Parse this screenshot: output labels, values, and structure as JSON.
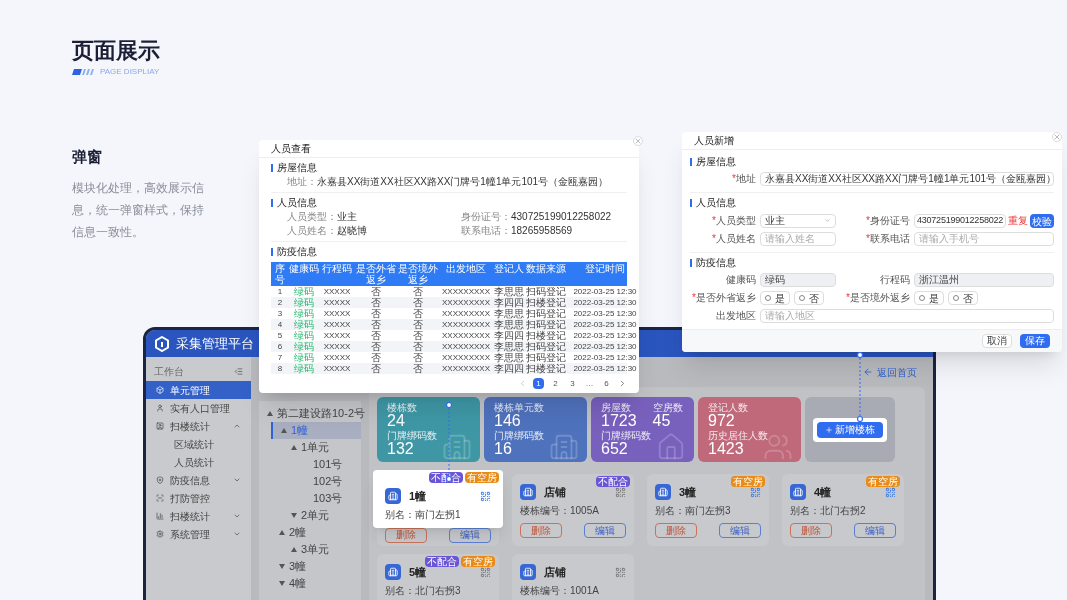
{
  "page": {
    "title": "页面展示",
    "subtitle": "PAGE DISPLIAY"
  },
  "section": {
    "title": "弹窗",
    "description": "模块化处理，高效展示信息，统一弹窗样式，保持信息一致性。"
  },
  "app": {
    "logo_text": "采集管理平台",
    "sidebar": {
      "header": "工作台",
      "items": [
        {
          "label": "单元管理",
          "selected": true
        },
        {
          "label": "实有人口管理",
          "selected": false
        },
        {
          "label": "扫楼统计",
          "selected": false,
          "expanded": true,
          "children": [
            {
              "label": "区域统计",
              "selected": false
            },
            {
              "label": "人员统计",
              "selected": false
            }
          ]
        },
        {
          "label": "防疫信息",
          "selected": false,
          "expanded": false
        },
        {
          "label": "打防管控",
          "selected": false
        },
        {
          "label": "扫楼统计",
          "selected": false,
          "expanded": false
        },
        {
          "label": "系统管理",
          "selected": false,
          "expanded": false
        }
      ]
    },
    "tree": [
      {
        "label": "第二建设路10-2号",
        "selected": false,
        "expanded": true,
        "children": [
          {
            "label": "1幢",
            "selected": true,
            "expanded": true,
            "children": [
              {
                "label": "1单元",
                "selected": false,
                "expanded": true,
                "children": [
                  {
                    "label": "101号",
                    "selected": false
                  },
                  {
                    "label": "102号",
                    "selected": false
                  },
                  {
                    "label": "103号",
                    "selected": false
                  }
                ]
              },
              {
                "label": "2单元",
                "selected": false,
                "expanded": false
              }
            ]
          },
          {
            "label": "2幢",
            "selected": false,
            "expanded": true,
            "children": [
              {
                "label": "3单元",
                "selected": false,
                "expanded": true
              }
            ]
          },
          {
            "label": "3幢",
            "selected": false,
            "expanded": false
          },
          {
            "label": "4幢",
            "selected": false,
            "expanded": false
          }
        ]
      }
    ],
    "back_link": "返回首页",
    "stats": [
      {
        "color": "#3f97a6",
        "rows": [
          [
            {
              "label": "楼栋数",
              "value": "24"
            }
          ],
          [
            {
              "label": "门牌绑码数",
              "value": "132"
            }
          ]
        ]
      },
      {
        "color": "#4f72bd",
        "rows": [
          [
            {
              "label": "楼栋单元数",
              "value": "146"
            }
          ],
          [
            {
              "label": "门牌绑码数",
              "value": "16"
            }
          ]
        ]
      },
      {
        "color": "#7860bd",
        "rows": [
          [
            {
              "label": "房屋数",
              "value": "1723"
            },
            {
              "label": "空房数",
              "value": "45"
            }
          ],
          [
            {
              "label": "门牌绑码数",
              "value": "652"
            }
          ]
        ]
      },
      {
        "color": "#c0697b",
        "rows": [
          [
            {
              "label": "登记人数",
              "value": "972"
            }
          ],
          [
            {
              "label": "历史居住人数",
              "value": "1423"
            }
          ]
        ]
      }
    ],
    "add_button": "新增楼栋",
    "buildings": [
      {
        "name": "1幢",
        "info": "别名：南门左拐1",
        "highlighted": true,
        "bound": true,
        "tags": [
          {
            "label": "不配合",
            "color": "#6a55d8"
          },
          {
            "label": "有空房",
            "color": "#e88b17"
          }
        ],
        "buttons": [
          "删除",
          "编辑"
        ]
      },
      {
        "name": "店铺",
        "info": "楼栋编号：1005A",
        "highlighted": false,
        "bound": false,
        "tags": [
          {
            "label": "不配合",
            "color": "#6a55d8"
          }
        ],
        "buttons": [
          "删除",
          "编辑"
        ]
      },
      {
        "name": "3幢",
        "info": "别名：南门左拐3",
        "highlighted": false,
        "bound": true,
        "tags": [
          {
            "label": "有空房",
            "color": "#e88b17"
          }
        ],
        "buttons": [
          "删除",
          "编辑"
        ]
      },
      {
        "name": "4幢",
        "info": "别名：北门右拐2",
        "highlighted": false,
        "bound": true,
        "tags": [
          {
            "label": "有空房",
            "color": "#e88b17"
          }
        ],
        "buttons": [
          "删除",
          "编辑"
        ]
      },
      {
        "name": "5幢",
        "info": "别名：北门右拐3",
        "highlighted": false,
        "bound": false,
        "tags": [
          {
            "label": "不配合",
            "color": "#6a55d8"
          },
          {
            "label": "有空房",
            "color": "#e88b17"
          }
        ]
      },
      {
        "name": "店铺",
        "info": "楼栋编号：1001A",
        "highlighted": false,
        "bound": false
      }
    ]
  },
  "view_dialog": {
    "title": "人员查看",
    "sections": [
      {
        "title": "房屋信息",
        "fields": [
          {
            "label": "地址：",
            "value": "永嘉县XX街道XX社区XX路XX门牌号1幢1单元101号（金瓯嘉园）"
          }
        ]
      },
      {
        "title": "人员信息",
        "fields": [
          {
            "label": "人员类型：",
            "value": "业主"
          },
          {
            "label": "身份证号：",
            "value": "430725199012258022"
          },
          {
            "label": "人员姓名：",
            "value": "赵晓博"
          },
          {
            "label": "联系电话：",
            "value": "18265958569"
          }
        ]
      },
      {
        "title": "防疫信息"
      }
    ],
    "table": {
      "columns": [
        "序号",
        "健康码",
        "行程码",
        "是否外省返乡",
        "是否境外返乡",
        "出发地区",
        "登记人",
        "数据来源",
        "登记时间"
      ],
      "rows": [
        [
          "1",
          "绿码",
          "XXXXX",
          "否",
          "否",
          "XXXXXXXXX",
          "李思思",
          "扫码登记",
          "2022-03-25 12:30"
        ],
        [
          "2",
          "绿码",
          "XXXXX",
          "否",
          "否",
          "XXXXXXXXX",
          "李四四",
          "扫楼登记",
          "2022-03-25 12:30"
        ],
        [
          "3",
          "绿码",
          "XXXXX",
          "否",
          "否",
          "XXXXXXXXX",
          "李思思",
          "扫码登记",
          "2022-03-25 12:30"
        ],
        [
          "4",
          "绿码",
          "XXXXX",
          "否",
          "否",
          "XXXXXXXXX",
          "李思思",
          "扫码登记",
          "2022-03-25 12:30"
        ],
        [
          "5",
          "绿码",
          "XXXXX",
          "否",
          "否",
          "XXXXXXXXX",
          "李四四",
          "扫楼登记",
          "2022-03-25 12:30"
        ],
        [
          "6",
          "绿码",
          "XXXXX",
          "否",
          "否",
          "XXXXXXXXX",
          "李思思",
          "扫码登记",
          "2022-03-25 12:30"
        ],
        [
          "7",
          "绿码",
          "XXXXX",
          "否",
          "否",
          "XXXXXXXXX",
          "李思思",
          "扫码登记",
          "2022-03-25 12:30"
        ],
        [
          "8",
          "绿码",
          "XXXXX",
          "否",
          "否",
          "XXXXXXXXX",
          "李四四",
          "扫楼登记",
          "2022-03-25 12:30"
        ]
      ]
    },
    "pages": [
      {
        "label": "1",
        "selected": true
      },
      {
        "label": "2",
        "selected": false
      },
      {
        "label": "3",
        "selected": false
      },
      {
        "label": "…",
        "selected": false
      },
      {
        "label": "6",
        "selected": false
      }
    ]
  },
  "add_dialog": {
    "title": "人员新增",
    "required_mark": "*",
    "sections": [
      {
        "title": "房屋信息",
        "fields": [
          {
            "kind": "text",
            "label": "地址",
            "required": true,
            "value": "永嘉县XX街道XX社区XX路XX门牌号1幢1单元101号（金瓯嘉园）",
            "wide": true
          }
        ]
      },
      {
        "title": "人员信息",
        "fields": [
          {
            "kind": "select",
            "label": "人员类型",
            "required": true,
            "value": "业主"
          },
          {
            "kind": "id",
            "label": "身份证号",
            "required": true,
            "value": "430725199012258022",
            "warning": "重复",
            "button": "校验"
          },
          {
            "kind": "text",
            "label": "人员姓名",
            "required": true,
            "placeholder": "请输入姓名"
          },
          {
            "kind": "text",
            "label": "联系电话",
            "required": true,
            "placeholder": "请输入手机号"
          }
        ]
      },
      {
        "title": "防疫信息",
        "fields": [
          {
            "kind": "text",
            "label": "健康码",
            "required": false,
            "value": "绿码",
            "disabled": true
          },
          {
            "kind": "text",
            "label": "行程码",
            "required": false,
            "value": "浙江温州",
            "disabled": true
          },
          {
            "kind": "radio",
            "label": "是否外省返乡",
            "required": true,
            "options": [
              {
                "label": "是",
                "selected": false
              },
              {
                "label": "否",
                "selected": false
              }
            ]
          },
          {
            "kind": "radio",
            "label": "是否境外返乡",
            "required": true,
            "options": [
              {
                "label": "是",
                "selected": false
              },
              {
                "label": "否",
                "selected": false
              }
            ]
          },
          {
            "kind": "text",
            "label": "出发地区",
            "required": false,
            "placeholder": "请输入地区",
            "wide": true
          }
        ]
      }
    ],
    "buttons": [
      "取消",
      "保存"
    ]
  }
}
